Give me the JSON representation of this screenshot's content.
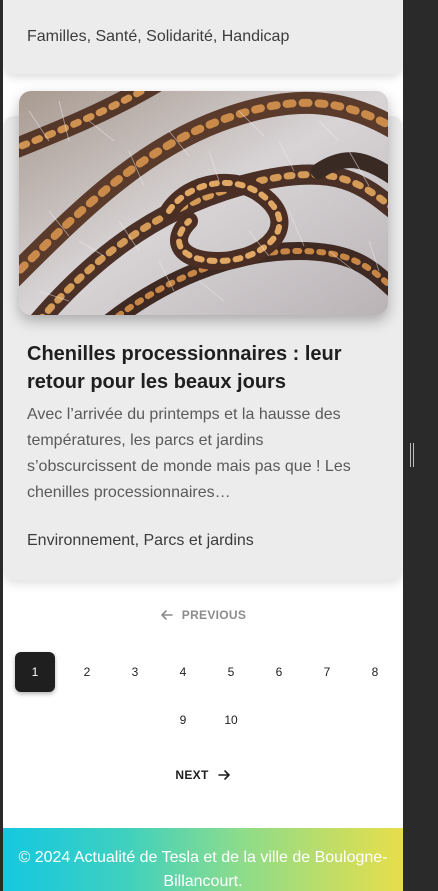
{
  "previous_card": {
    "categories": "Familles, Santé, Solidarité, Handicap"
  },
  "article": {
    "image_name": "caterpillars-photo",
    "title": "Chenilles processionnaires : leur retour pour les beaux jours",
    "excerpt": "Avec l’arrivée du printemps et la hausse des températures, les parcs et jardins s’obscurcissent de monde mais pas que ! Les chenilles processionnaires…",
    "categories": "Environnement, Parcs et jardins"
  },
  "pagination": {
    "previous_label": "PREVIOUS",
    "next_label": "NEXT",
    "pages": [
      "1",
      "2",
      "3",
      "4",
      "5",
      "6",
      "7",
      "8",
      "9",
      "10"
    ],
    "current": "1"
  },
  "footer": {
    "text": "© 2024 Actualité de Tesla et de la ville de Boulogne-Billancourt."
  },
  "colors": {
    "card_bg": "#ececec",
    "active_page": "#1f1f1f",
    "footer_gradient": [
      "#14c8e0",
      "#8edc8a",
      "#e8de4a"
    ]
  }
}
